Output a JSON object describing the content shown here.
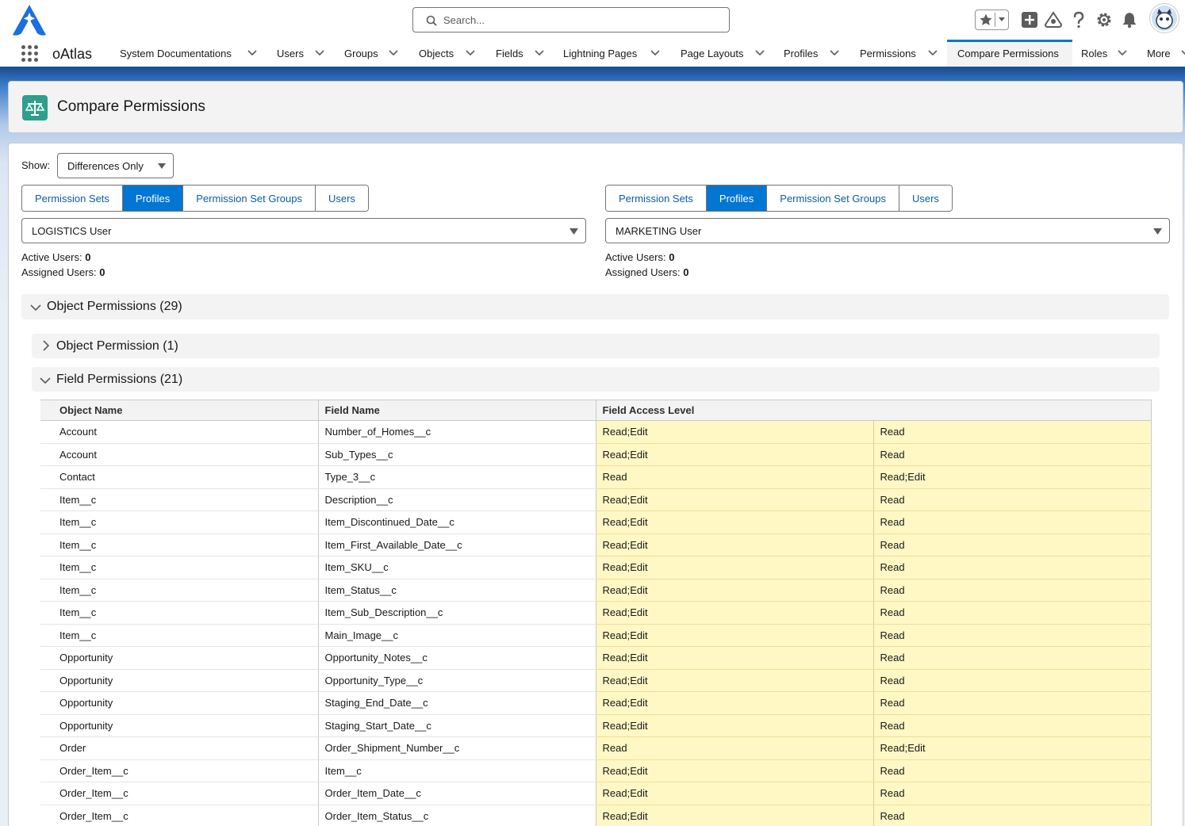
{
  "header": {
    "search_placeholder": "Search..."
  },
  "nav": {
    "app_name": "oAtlas",
    "items": [
      {
        "label": "System Documentations"
      },
      {
        "label": "Users"
      },
      {
        "label": "Groups"
      },
      {
        "label": "Objects"
      },
      {
        "label": "Fields"
      },
      {
        "label": "Lightning Pages"
      },
      {
        "label": "Page Layouts"
      },
      {
        "label": "Profiles"
      },
      {
        "label": "Permissions"
      },
      {
        "label": "Compare Permissions"
      },
      {
        "label": "Roles"
      },
      {
        "label": "More"
      }
    ],
    "active": "Compare Permissions"
  },
  "page": {
    "title": "Compare Permissions",
    "show_label": "Show:",
    "show_value": "Differences Only"
  },
  "left": {
    "tabs": [
      "Permission Sets",
      "Profiles",
      "Permission Set Groups",
      "Users"
    ],
    "selected_tab": "Profiles",
    "selection": "LOGISTICS User",
    "active_users_label": "Active Users:",
    "active_users": "0",
    "assigned_users_label": "Assigned Users:",
    "assigned_users": "0"
  },
  "right": {
    "tabs": [
      "Permission Sets",
      "Profiles",
      "Permission Set Groups",
      "Users"
    ],
    "selected_tab": "Profiles",
    "selection": "MARKETING User",
    "active_users_label": "Active Users:",
    "active_users": "0",
    "assigned_users_label": "Assigned Users:",
    "assigned_users": "0"
  },
  "sections": {
    "object_permissions": "Object Permissions (29)",
    "object_permission": "Object Permission (1)",
    "field_permissions": "Field Permissions (21)"
  },
  "table": {
    "headers": [
      "Object Name",
      "Field Name",
      "Field Access Level"
    ],
    "rows": [
      [
        "Account",
        "Number_of_Homes__c",
        "Read;Edit",
        "Read"
      ],
      [
        "Account",
        "Sub_Types__c",
        "Read;Edit",
        "Read"
      ],
      [
        "Contact",
        "Type_3__c",
        "Read",
        "Read;Edit"
      ],
      [
        "Item__c",
        "Description__c",
        "Read;Edit",
        "Read"
      ],
      [
        "Item__c",
        "Item_Discontinued_Date__c",
        "Read;Edit",
        "Read"
      ],
      [
        "Item__c",
        "Item_First_Available_Date__c",
        "Read;Edit",
        "Read"
      ],
      [
        "Item__c",
        "Item_SKU__c",
        "Read;Edit",
        "Read"
      ],
      [
        "Item__c",
        "Item_Status__c",
        "Read;Edit",
        "Read"
      ],
      [
        "Item__c",
        "Item_Sub_Description__c",
        "Read;Edit",
        "Read"
      ],
      [
        "Item__c",
        "Main_Image__c",
        "Read;Edit",
        "Read"
      ],
      [
        "Opportunity",
        "Opportunity_Notes__c",
        "Read;Edit",
        "Read"
      ],
      [
        "Opportunity",
        "Opportunity_Type__c",
        "Read;Edit",
        "Read"
      ],
      [
        "Opportunity",
        "Staging_End_Date__c",
        "Read;Edit",
        "Read"
      ],
      [
        "Opportunity",
        "Staging_Start_Date__c",
        "Read;Edit",
        "Read"
      ],
      [
        "Order",
        "Order_Shipment_Number__c",
        "Read",
        "Read;Edit"
      ],
      [
        "Order_Item__c",
        "Item__c",
        "Read;Edit",
        "Read"
      ],
      [
        "Order_Item__c",
        "Order_Item_Date__c",
        "Read;Edit",
        "Read"
      ],
      [
        "Order_Item__c",
        "Order_Item_Status__c",
        "Read;Edit",
        "Read"
      ]
    ]
  },
  "colors": {
    "brand_blue": "#0176d3",
    "nav_bar": "#1b5297",
    "diff_highlight": "#fff8c5",
    "title_icon": "#2e9f8c"
  },
  "icons": [
    "app-logo-icon",
    "search-icon",
    "star-icon",
    "add-icon",
    "trailhead-icon",
    "help-icon",
    "gear-icon",
    "bell-icon",
    "waffle-icon",
    "scales-icon",
    "chevron-down-icon",
    "chevron-right-icon"
  ]
}
